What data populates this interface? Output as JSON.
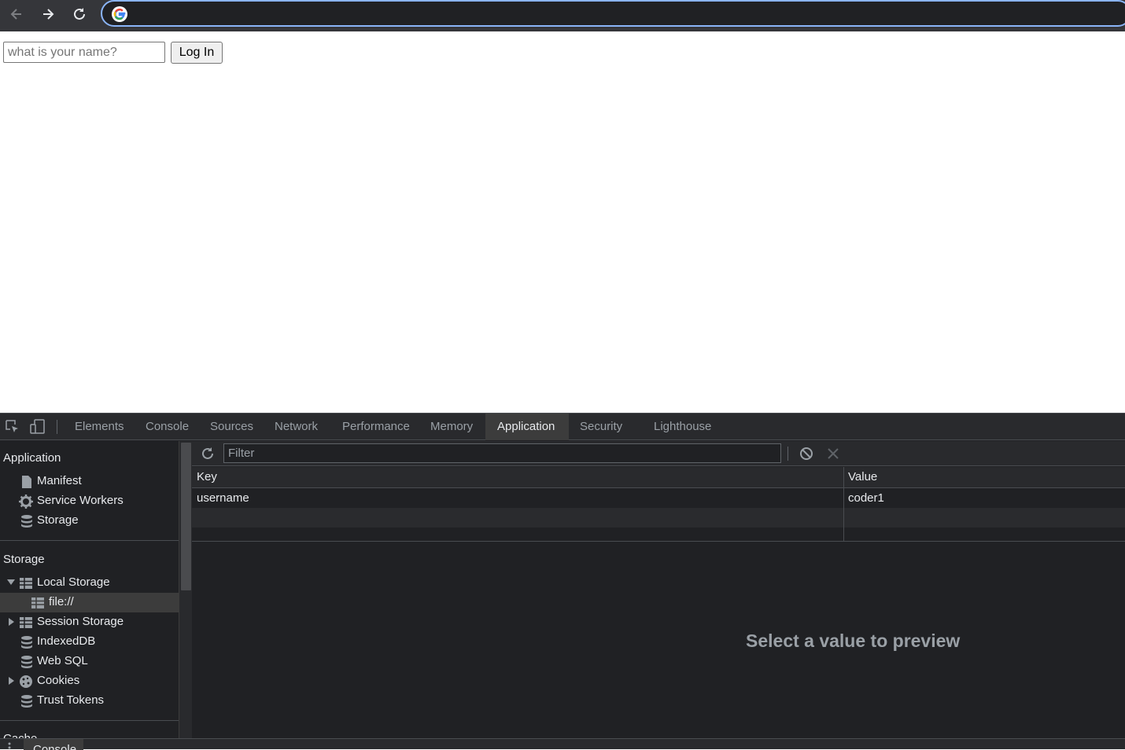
{
  "browser": {
    "back_icon": "arrow-left-icon",
    "forward_icon": "arrow-right-icon",
    "reload_icon": "reload-icon",
    "omnibox_value": "",
    "omnibox_icon": "google-g-icon"
  },
  "page": {
    "name_input": {
      "placeholder": "what is your name?",
      "value": ""
    },
    "login_button": "Log In"
  },
  "devtools": {
    "tabs": [
      "Elements",
      "Console",
      "Sources",
      "Network",
      "Performance",
      "Memory",
      "Application",
      "Security",
      "Lighthouse"
    ],
    "active_tab": "Application",
    "sidebar": {
      "application_header": "Application",
      "application_items": [
        {
          "label": "Manifest",
          "icon": "file-icon"
        },
        {
          "label": "Service Workers",
          "icon": "gear-icon"
        },
        {
          "label": "Storage",
          "icon": "database-icon"
        }
      ],
      "storage_header": "Storage",
      "storage_items": [
        {
          "label": "Local Storage",
          "icon": "table-icon",
          "expanded": true
        },
        {
          "label": "file://",
          "icon": "table-icon",
          "selected": true
        },
        {
          "label": "Session Storage",
          "icon": "table-icon",
          "expanded": false
        },
        {
          "label": "IndexedDB",
          "icon": "database-icon"
        },
        {
          "label": "Web SQL",
          "icon": "database-icon"
        },
        {
          "label": "Cookies",
          "icon": "cookie-icon",
          "expanded": false
        },
        {
          "label": "Trust Tokens",
          "icon": "database-icon"
        }
      ],
      "cache_header_partial": "Cache"
    },
    "toolbar": {
      "filter_placeholder": "Filter",
      "refresh_icon": "refresh-icon",
      "clear_all_icon": "block-icon",
      "delete_icon": "close-icon"
    },
    "table": {
      "columns": [
        "Key",
        "Value"
      ],
      "rows": [
        {
          "key": "username",
          "value": "coder1"
        }
      ]
    },
    "preview_text": "Select a value to preview",
    "drawer_tab": "Console"
  },
  "colors": {
    "devtools_bg": "#202124",
    "accent_blue": "#8ab4f8",
    "text": "#e8eaed",
    "muted_text": "#9aa0a6"
  }
}
